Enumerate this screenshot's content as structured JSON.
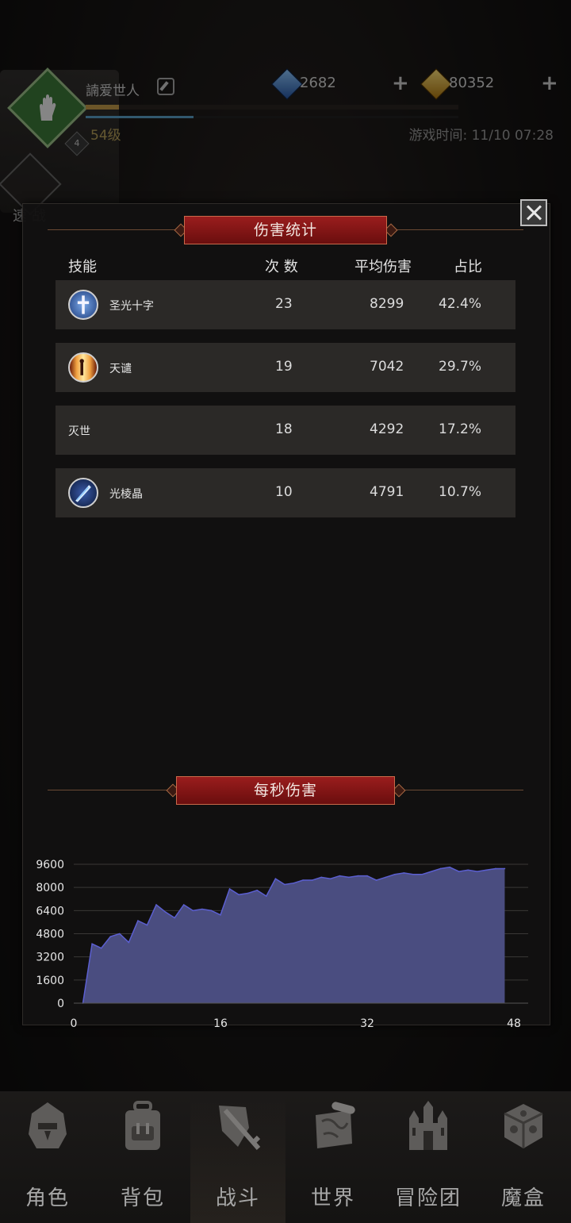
{
  "player": {
    "name": "諵爱世人",
    "level": "54级",
    "badge_level": "4",
    "xp_fraction": 0.09,
    "mp_fraction": 0.29,
    "game_time": "游戏时间: 11/10 07:28"
  },
  "currency": {
    "gems": "2682",
    "gold": "80352",
    "gem_color": "#3c78c8",
    "gold_color": "#d4a020"
  },
  "speed_label": "速  战",
  "modal": {
    "title": "伤害统计",
    "dps_title": "每秒伤害"
  },
  "table": {
    "headers": [
      "技能",
      "次 数",
      "平均伤害",
      "占比"
    ],
    "rows": [
      {
        "name": "圣光十字",
        "count": "23",
        "avg": "8299",
        "pct": "42.4%",
        "icon": "holy-cross-icon"
      },
      {
        "name": "天谴",
        "count": "19",
        "avg": "7042",
        "pct": "29.7%",
        "icon": "divine-wrath-icon"
      },
      {
        "name": "灭世",
        "count": "18",
        "avg": "4292",
        "pct": "17.2%",
        "icon": ""
      },
      {
        "name": "光棱晶",
        "count": "10",
        "avg": "4791",
        "pct": "10.7%",
        "icon": "prism-crystal-icon"
      }
    ]
  },
  "chart_data": {
    "type": "area",
    "title": "每秒伤害",
    "xlabel": "",
    "ylabel": "",
    "xlim": [
      0,
      48
    ],
    "ylim": [
      0,
      9600
    ],
    "x_ticks": [
      "0",
      "16",
      "32",
      "48"
    ],
    "y_ticks": [
      "0",
      "1600",
      "3200",
      "4800",
      "6400",
      "8000",
      "9600"
    ],
    "grid": true,
    "fill_color": "#4a4d80",
    "line_color": "#5b5fd0",
    "x": [
      1,
      2,
      3,
      4,
      5,
      6,
      7,
      8,
      9,
      10,
      11,
      12,
      13,
      14,
      15,
      16,
      17,
      18,
      19,
      20,
      21,
      22,
      23,
      24,
      25,
      26,
      27,
      28,
      29,
      30,
      31,
      32,
      33,
      34,
      35,
      36,
      37,
      38,
      39,
      40,
      41,
      42,
      43,
      44,
      45,
      46,
      47
    ],
    "values": [
      0,
      4100,
      3800,
      4600,
      4800,
      4200,
      5700,
      5400,
      6800,
      6300,
      5900,
      6800,
      6400,
      6500,
      6400,
      6100,
      7900,
      7500,
      7600,
      7800,
      7400,
      8600,
      8200,
      8300,
      8500,
      8500,
      8700,
      8600,
      8800,
      8700,
      8800,
      8800,
      8500,
      8700,
      8900,
      9000,
      8900,
      8900,
      9100,
      9300,
      9400,
      9100,
      9200,
      9100,
      9200,
      9300,
      9300
    ]
  },
  "nav": [
    {
      "label": "角色",
      "icon": "helmet-icon"
    },
    {
      "label": "背包",
      "icon": "backpack-icon"
    },
    {
      "label": "战斗",
      "icon": "swords-shield-icon"
    },
    {
      "label": "世界",
      "icon": "world-map-icon"
    },
    {
      "label": "冒险团",
      "icon": "castle-icon"
    },
    {
      "label": "魔盒",
      "icon": "magic-box-icon"
    }
  ]
}
